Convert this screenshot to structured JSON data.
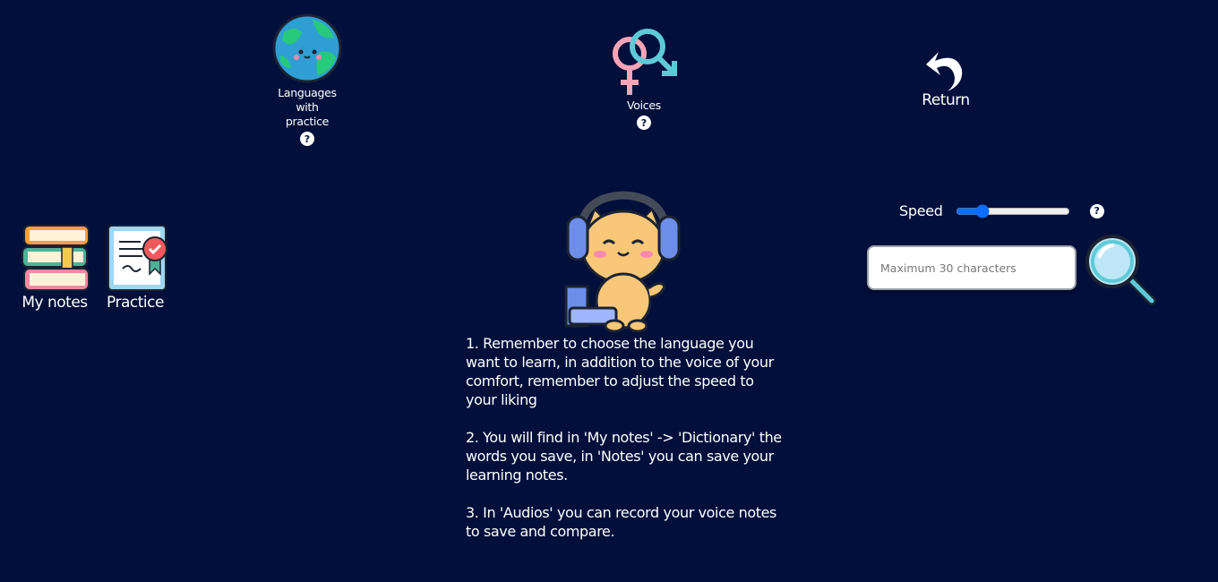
{
  "top_nav": {
    "languages_label": "Languages with practice",
    "languages_help": "?",
    "voices_label": "Voices",
    "voices_help": "?",
    "return_label": "Return"
  },
  "side_tiles": {
    "notes_label": "My notes",
    "practice_label": "Practice"
  },
  "controls": {
    "speed_label": "Speed",
    "speed_value": 0.2,
    "speed_help": "?",
    "search_placeholder": "Maximum 30 characters"
  },
  "instructions": [
    "1. Remember to choose the language you want to learn, in addition to the voice of your comfort, remember to adjust the speed to your liking",
    "2. You will find in 'My notes' -> 'Dictionary' the words you save, in 'Notes' you can save your learning notes.",
    "3. In 'Audios' you can record your voice notes to save and compare."
  ],
  "colors": {
    "background": "#010f3b",
    "text": "#ffffff",
    "accent": "#0d6efd"
  }
}
